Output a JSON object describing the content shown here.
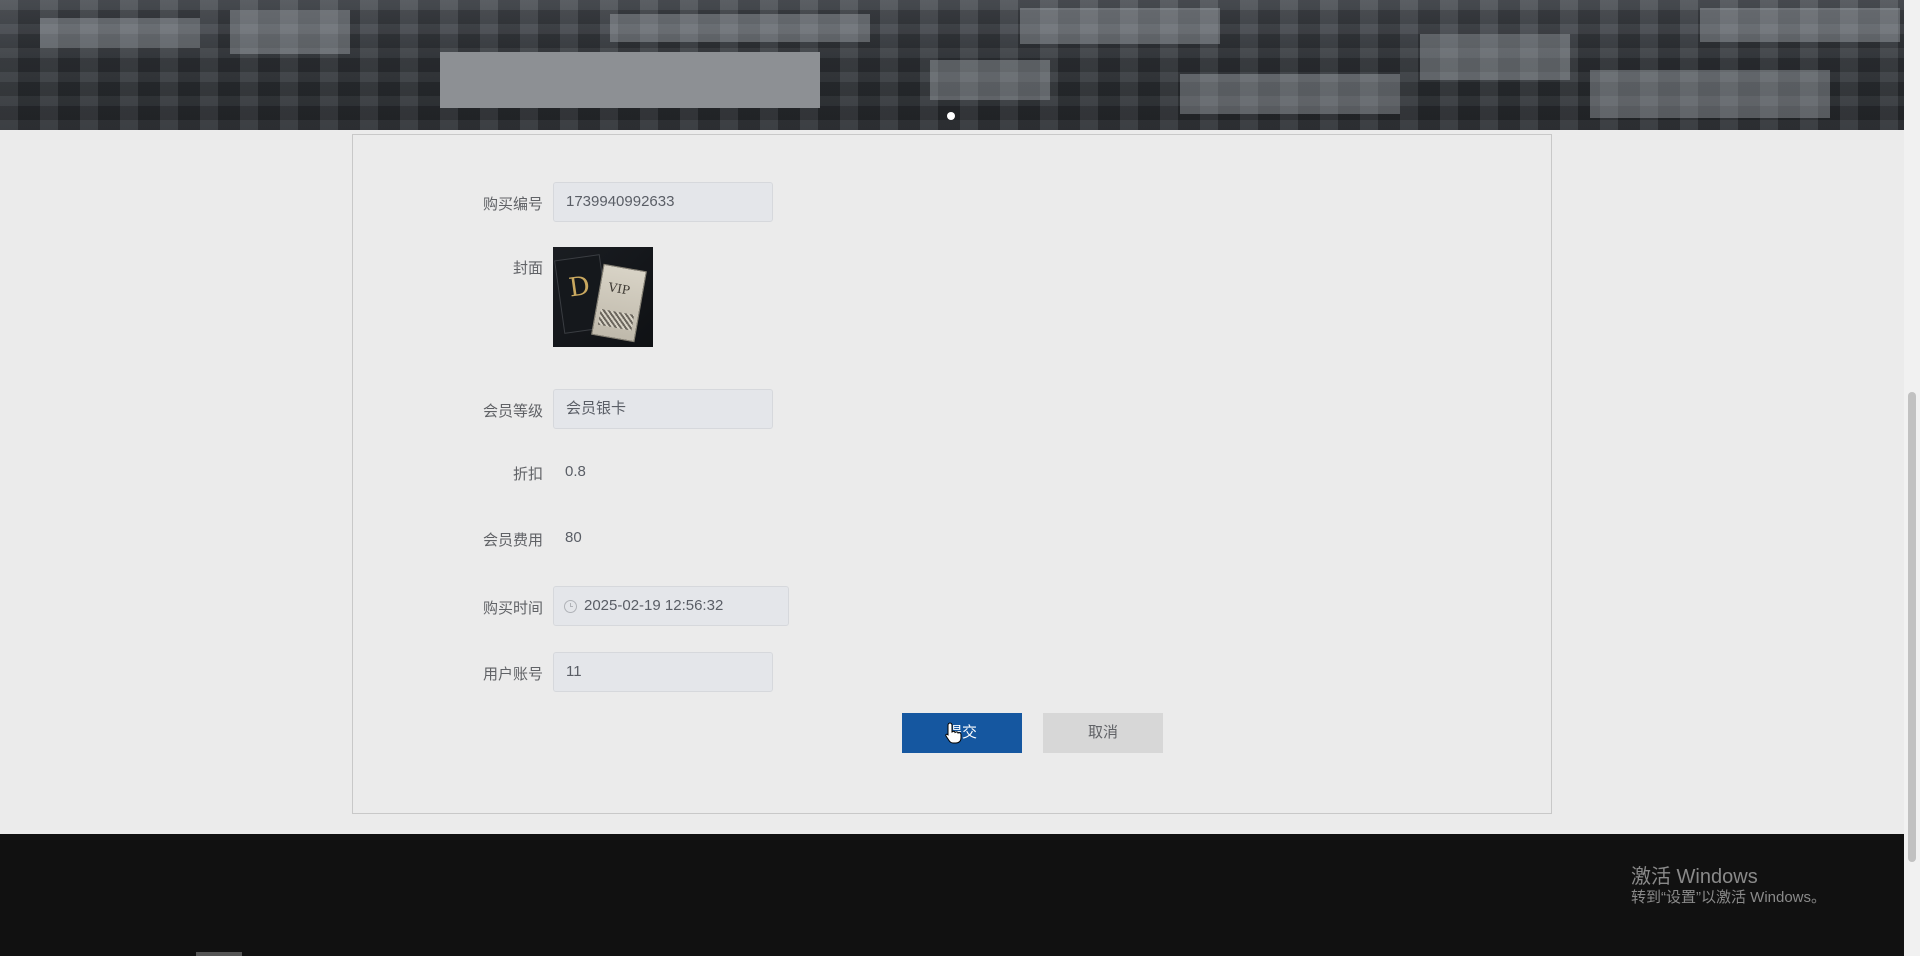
{
  "form": {
    "purchase_number": {
      "label": "购买编号",
      "value": "1739940992633"
    },
    "cover": {
      "label": "封面",
      "image": "vip-membership-cards",
      "text_left": "D",
      "text_right": "VIP"
    },
    "member_level": {
      "label": "会员等级",
      "value": "会员银卡"
    },
    "discount": {
      "label": "折扣",
      "value": "0.8"
    },
    "member_fee": {
      "label": "会员费用",
      "value": "80"
    },
    "purchase_time": {
      "label": "购买时间",
      "value": "2025-02-19 12:56:32",
      "icon": "clock-icon"
    },
    "user_account": {
      "label": "用户账号",
      "value": "11"
    }
  },
  "buttons": {
    "submit": "提交",
    "cancel": "取消"
  },
  "banner": {
    "active_slide": 1,
    "slide_count": 1
  },
  "watermark": {
    "title": "激活 Windows",
    "subtitle": "转到“设置”以激活 Windows。"
  },
  "colors": {
    "primary": "#1557a0",
    "footer": "#111111",
    "background": "#ebebeb"
  }
}
